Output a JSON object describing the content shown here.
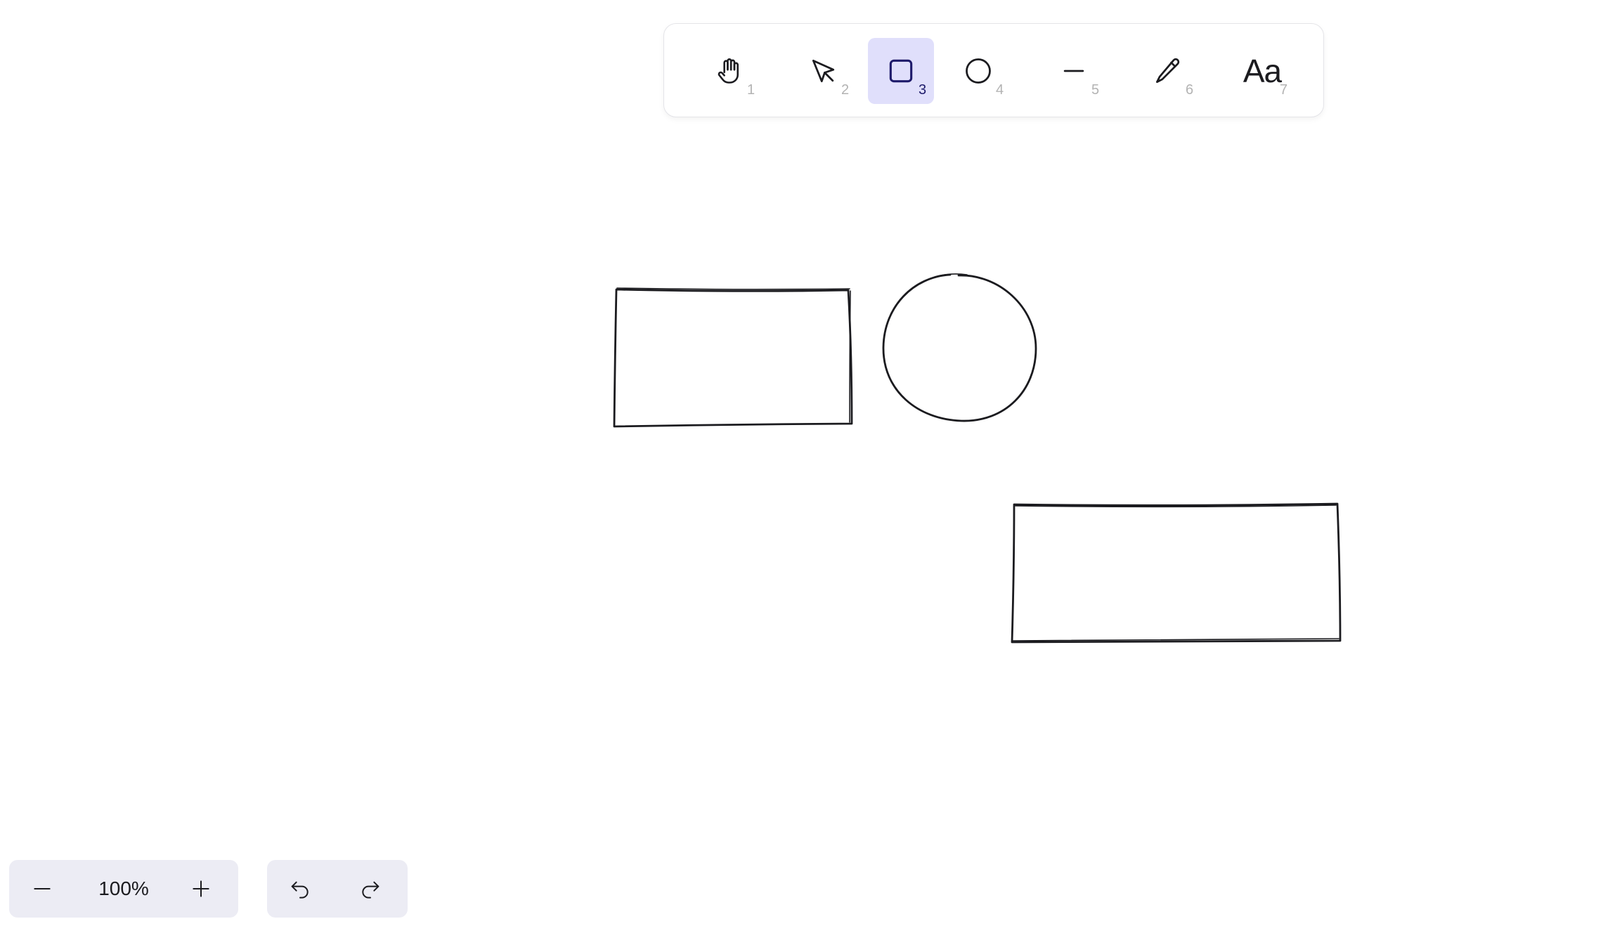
{
  "toolbar": {
    "tools": [
      {
        "name": "hand",
        "icon": "hand-icon",
        "shortcut": "1",
        "active": false
      },
      {
        "name": "select",
        "icon": "pointer-icon",
        "shortcut": "2",
        "active": false
      },
      {
        "name": "rectangle",
        "icon": "rectangle-icon",
        "shortcut": "3",
        "active": true
      },
      {
        "name": "ellipse",
        "icon": "circle-icon",
        "shortcut": "4",
        "active": false
      },
      {
        "name": "line",
        "icon": "line-icon",
        "shortcut": "5",
        "active": false
      },
      {
        "name": "pencil",
        "icon": "pencil-icon",
        "shortcut": "6",
        "active": false
      },
      {
        "name": "text",
        "icon": "text-icon",
        "label": "Aa",
        "shortcut": "7",
        "active": false
      }
    ],
    "active_color": "#e0dffb"
  },
  "canvas": {
    "shapes": [
      {
        "type": "rectangle"
      },
      {
        "type": "ellipse"
      },
      {
        "type": "rectangle"
      }
    ],
    "stroke_color": "#1b1b1f"
  },
  "zoom": {
    "value": "100%",
    "out_icon": "minus-icon",
    "in_icon": "plus-icon"
  },
  "history": {
    "undo_icon": "undo-icon",
    "redo_icon": "redo-icon"
  }
}
